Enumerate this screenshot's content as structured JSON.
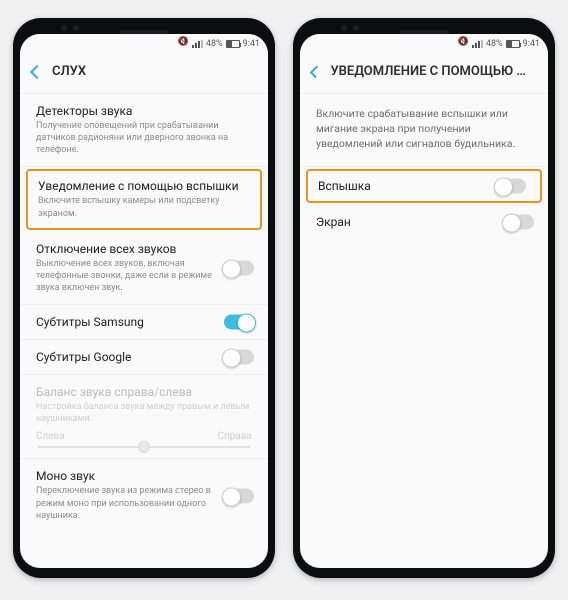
{
  "status": {
    "battery": "48%",
    "time": "9:41"
  },
  "left": {
    "header": "СЛУХ",
    "items": {
      "detectors_title": "Детекторы звука",
      "detectors_sub": "Получение оповещений при срабатывании датчиков радионяни или дверного звонка на телефоне.",
      "flash_notif_title": "Уведомление с помощью вспышки",
      "flash_notif_sub": "Включите вспышку камеры или подсветку экраном.",
      "mute_all_title": "Отключение всех звуков",
      "mute_all_sub": "Выключение всех звуков, включая телефонные звонки, даже если в режиме звука включен звук.",
      "sub_samsung": "Субтитры Samsung",
      "sub_google": "Субтитры Google",
      "balance_title": "Баланс звука справа/слева",
      "balance_sub": "Настройка баланса звука между правым и левым наушниками.",
      "balance_left": "Слева",
      "balance_right": "Справа",
      "mono_title": "Моно звук",
      "mono_sub": "Переключение звука из режима стерео в режим моно при использовании одного наушника."
    }
  },
  "right": {
    "header": "УВЕДОМЛЕНИЕ С ПОМОЩЬЮ ВСПЫШКИ",
    "desc": "Включите срабатывание вспышки или мигание экрана при получении уведомлений или сигналов будильника.",
    "flash_label": "Вспышка",
    "screen_label": "Экран"
  }
}
